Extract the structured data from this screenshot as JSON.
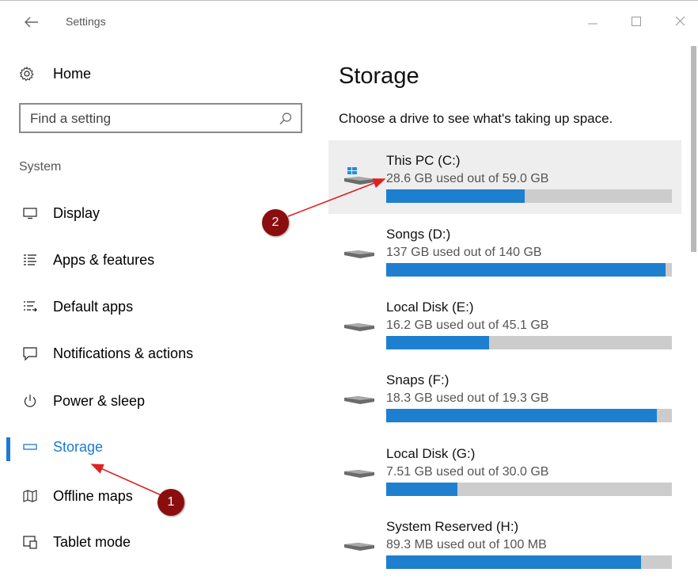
{
  "window": {
    "title": "Settings",
    "back_icon": "back-arrow-icon",
    "buttons": [
      "minimize",
      "maximize",
      "close"
    ]
  },
  "sidebar": {
    "home_label": "Home",
    "search_placeholder": "Find a setting",
    "section_label": "System",
    "items": [
      {
        "label": "Display",
        "icon": "display-icon"
      },
      {
        "label": "Apps & features",
        "icon": "apps-features-icon"
      },
      {
        "label": "Default apps",
        "icon": "default-apps-icon"
      },
      {
        "label": "Notifications & actions",
        "icon": "notifications-icon"
      },
      {
        "label": "Power & sleep",
        "icon": "power-icon"
      },
      {
        "label": "Storage",
        "icon": "storage-icon",
        "active": true
      },
      {
        "label": "Offline maps",
        "icon": "map-icon"
      },
      {
        "label": "Tablet mode",
        "icon": "tablet-mode-icon"
      }
    ]
  },
  "main": {
    "title": "Storage",
    "description": "Choose a drive to see what's taking up space.",
    "drives": [
      {
        "name": "This PC (C:)",
        "usage": "28.6 GB used out of 59.0 GB",
        "used_fraction": 0.485,
        "selected": true,
        "icon": "windows-drive-icon"
      },
      {
        "name": "Songs (D:)",
        "usage": "137 GB used out of 140 GB",
        "used_fraction": 0.979,
        "icon": "drive-icon"
      },
      {
        "name": "Local Disk (E:)",
        "usage": "16.2 GB used out of 45.1 GB",
        "used_fraction": 0.359,
        "icon": "drive-icon"
      },
      {
        "name": "Snaps (F:)",
        "usage": "18.3 GB used out of 19.3 GB",
        "used_fraction": 0.948,
        "icon": "drive-icon"
      },
      {
        "name": "Local Disk (G:)",
        "usage": "7.51 GB used out of 30.0 GB",
        "used_fraction": 0.25,
        "icon": "drive-icon"
      },
      {
        "name": "System Reserved (H:)",
        "usage": "89.3 MB used out of 100 MB",
        "used_fraction": 0.893,
        "icon": "drive-icon"
      }
    ]
  },
  "annotations": {
    "callout_1": "1",
    "callout_2": "2",
    "color": "#8b0e0e",
    "arrow_color": "#e02020"
  },
  "colors": {
    "accent": "#1a7ad4",
    "bar_fill": "#1e7fcf",
    "bar_track": "#cccccc",
    "selected_row": "#eeeeee"
  }
}
